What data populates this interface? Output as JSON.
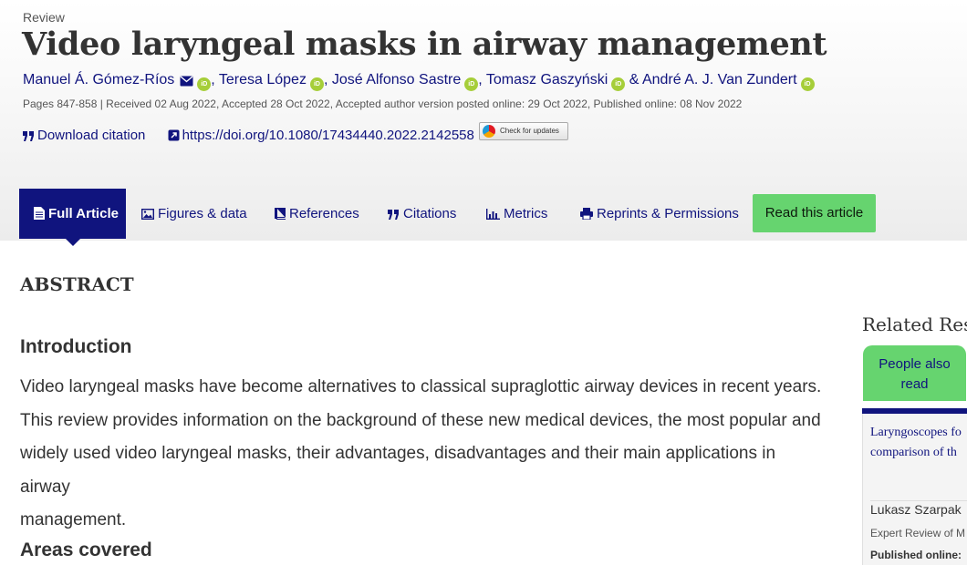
{
  "article": {
    "type": "Review",
    "title": "Video laryngeal masks in airway management",
    "authors": [
      {
        "name": "Manuel Á. Gómez-Ríos",
        "separator": ""
      },
      {
        "name": "Teresa López",
        "separator": ", "
      },
      {
        "name": "José Alfonso Sastre",
        "separator": ", "
      },
      {
        "name": "Tomasz Gaszyński",
        "separator": ", "
      },
      {
        "name": "André A. J. Van Zundert",
        "separator": " & "
      }
    ],
    "orcid_label": "iD",
    "pub_info": "Pages 847-858 | Received 02 Aug 2022, Accepted 28 Oct 2022, Accepted author version posted online: 29 Oct 2022, Published online: 08 Nov 2022"
  },
  "actions": {
    "download_citation": "Download citation",
    "doi": "https://doi.org/10.1080/17434440.2022.2142558",
    "check_updates": "Check for updates"
  },
  "tabs": [
    {
      "label": "Full Article",
      "icon": "document-icon",
      "active": true
    },
    {
      "label": "Figures & data",
      "icon": "image-icon",
      "active": false
    },
    {
      "label": "References",
      "icon": "book-icon",
      "active": false
    },
    {
      "label": "Citations",
      "icon": "quote-icon",
      "active": false
    },
    {
      "label": "Metrics",
      "icon": "bar-chart-icon",
      "active": false
    },
    {
      "label": "Reprints & Permissions",
      "icon": "print-icon",
      "active": false
    }
  ],
  "read_button": "Read this article",
  "abstract": {
    "heading": "ABSTRACT",
    "sections": [
      {
        "heading": "Introduction",
        "lines": [
          "Video laryngeal masks have become alternatives to classical supraglottic airway devices in recent years.",
          "This review provides information on the background of these new medical devices, the most popular and",
          "widely used video laryngeal masks, their advantages, disadvantages and their main applications in airway",
          "management."
        ]
      },
      {
        "heading": "Areas covered"
      }
    ]
  },
  "related": {
    "title": "Related Rese",
    "tab_label_line1": "People also",
    "tab_label_line2": "read",
    "card": {
      "title_line1": "Laryngoscopes fo",
      "title_line2": "comparison of th",
      "author": "Lukasz Szarpak",
      "journal": "Expert Review of M",
      "published": "Published online:"
    }
  },
  "colors": {
    "brand_navy": "#10147e",
    "accent_green": "#66d46f",
    "orcid_green": "#a6ce39"
  }
}
